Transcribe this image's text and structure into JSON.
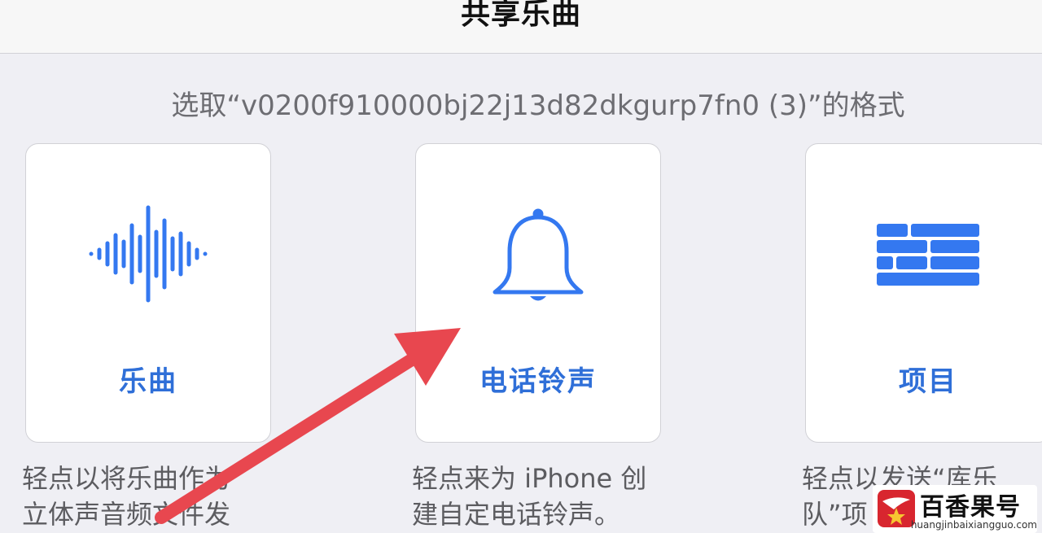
{
  "header": {
    "title": "共享乐曲"
  },
  "prompt": {
    "text": "选取“v0200f910000bj22j13d82dkgurp7fn0 (3)”的格式"
  },
  "options": [
    {
      "label": "乐曲",
      "icon": "waveform-icon",
      "description_line1": "轻点以将乐曲作为",
      "description_line2": "立体声音频文件发"
    },
    {
      "label": "电话铃声",
      "icon": "bell-icon",
      "description_line1": "轻点来为 iPhone 创",
      "description_line2": "建自定电话铃声。"
    },
    {
      "label": "项目",
      "icon": "bricks-icon",
      "description_line1": "轻点以发送“库乐",
      "description_line2": "队”项"
    }
  ],
  "watermark": {
    "name": "百香果号",
    "url": "huangjinbaixiangguo.com"
  },
  "colors": {
    "accent": "#2f6fd8",
    "arrow": "#e8474f",
    "background": "#efeff4",
    "card": "#ffffff"
  }
}
